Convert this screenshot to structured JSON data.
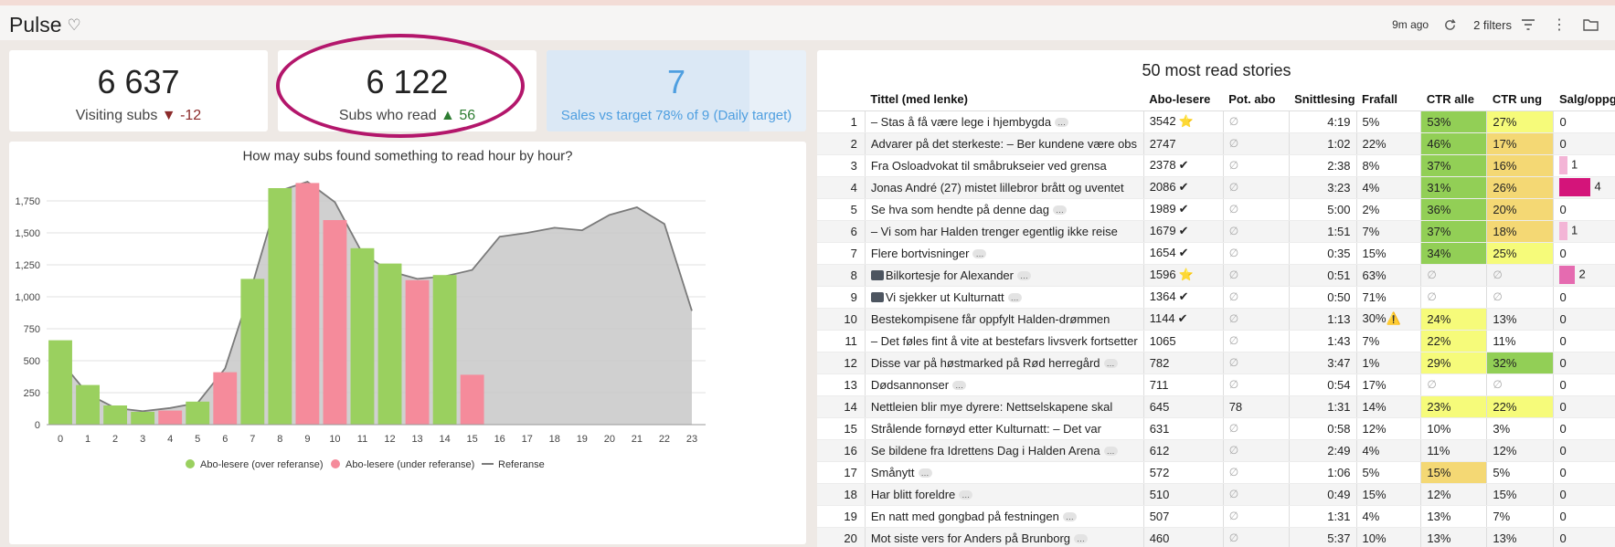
{
  "header": {
    "title": "Pulse",
    "updated": "9m ago",
    "filters": "2 filters"
  },
  "kpis": [
    {
      "value": "6 637",
      "label": "Visiting subs",
      "delta": "▼ -12",
      "delta_dir": "down"
    },
    {
      "value": "6 122",
      "label": "Subs who read",
      "delta": "▲ 56",
      "delta_dir": "up"
    },
    {
      "value": "7",
      "label": "Sales vs target 78% of 9 (Daily target)",
      "progress": 0.78
    }
  ],
  "colors": {
    "over": "#9ad05f",
    "under": "#f58b9b",
    "reference_area": "#c8c8c8",
    "reference_line": "#7a7a7a",
    "ctr_green": "#92cf56",
    "ctr_yellow": "#f6fb7a",
    "ctr_orange": "#f4d874",
    "sales_bar": "#d4147a"
  },
  "chart_data": {
    "type": "bar",
    "title": "How may subs found something to read hour by hour?",
    "categories": [
      "0",
      "1",
      "2",
      "3",
      "4",
      "5",
      "6",
      "7",
      "8",
      "9",
      "10",
      "11",
      "12",
      "13",
      "14",
      "15",
      "16",
      "17",
      "18",
      "19",
      "20",
      "21",
      "22",
      "23"
    ],
    "ylim": [
      0,
      2000
    ],
    "yticks": [
      "0",
      "250",
      "500",
      "750",
      "1,000",
      "1,250",
      "1,500",
      "1,750"
    ],
    "series": [
      {
        "name": "Abo-lesere (over referanse)",
        "values": [
          660,
          310,
          150,
          100,
          null,
          180,
          null,
          1140,
          1850,
          null,
          null,
          1380,
          1260,
          null,
          1170,
          null,
          null,
          null,
          null,
          null,
          null,
          null,
          null,
          null
        ]
      },
      {
        "name": "Abo-lesere (under referanse)",
        "values": [
          null,
          null,
          null,
          null,
          110,
          null,
          410,
          null,
          null,
          1890,
          1600,
          null,
          null,
          1130,
          null,
          390,
          null,
          null,
          null,
          null,
          null,
          null,
          null,
          null
        ]
      },
      {
        "name": "Referanse",
        "type": "area",
        "values": [
          500,
          240,
          130,
          105,
          130,
          170,
          440,
          1100,
          1830,
          1900,
          1740,
          1340,
          1200,
          1140,
          1160,
          1210,
          1470,
          1500,
          1540,
          1520,
          1640,
          1700,
          1570,
          890
        ]
      }
    ]
  },
  "table": {
    "title": "50 most read stories",
    "columns": [
      "",
      "Tittel (med lenke)",
      "Abo-lesere",
      "Pot. abo",
      "Snittlesing",
      "Frafall",
      "CTR alle",
      "CTR ung",
      "Salg/oppgr"
    ],
    "rows": [
      {
        "idx": "1",
        "title": "– Stas å få være lege i hjembygda",
        "dots": "…",
        "abo": "3542",
        "badge": "⭐",
        "pot": "∅",
        "snitt": "4:19",
        "frafall": "5%",
        "ctr_alle": "53%",
        "ctr_alle_c": "green",
        "ctr_ung": "27%",
        "ctr_ung_c": "yellow",
        "salg": "0",
        "salg_val": 0
      },
      {
        "idx": "2",
        "title": "Advarer på det sterkeste: – Ber kundene være obs",
        "dots": "",
        "abo": "2747",
        "badge": "",
        "pot": "∅",
        "snitt": "1:02",
        "frafall": "22%",
        "ctr_alle": "46%",
        "ctr_alle_c": "green",
        "ctr_ung": "17%",
        "ctr_ung_c": "orange",
        "salg": "0",
        "salg_val": 0
      },
      {
        "idx": "3",
        "title": "Fra Osloadvokat til småbrukseier ved grensa",
        "dots": "",
        "abo": "2378",
        "badge": "✔",
        "pot": "∅",
        "snitt": "2:38",
        "frafall": "8%",
        "ctr_alle": "37%",
        "ctr_alle_c": "green",
        "ctr_ung": "16%",
        "ctr_ung_c": "orange",
        "salg": "1",
        "salg_val": 1
      },
      {
        "idx": "4",
        "title": "Jonas André (27) mistet lillebror brått og uventet",
        "dots": "",
        "abo": "2086",
        "badge": "✔",
        "pot": "∅",
        "snitt": "3:23",
        "frafall": "4%",
        "ctr_alle": "31%",
        "ctr_alle_c": "green",
        "ctr_ung": "26%",
        "ctr_ung_c": "orange",
        "salg": "4",
        "salg_val": 4
      },
      {
        "idx": "5",
        "title": "Se hva som hendte på denne dag",
        "dots": "…",
        "abo": "1989",
        "badge": "✔",
        "pot": "∅",
        "snitt": "5:00",
        "frafall": "2%",
        "ctr_alle": "36%",
        "ctr_alle_c": "green",
        "ctr_ung": "20%",
        "ctr_ung_c": "orange",
        "salg": "0",
        "salg_val": 0
      },
      {
        "idx": "6",
        "title": "– Vi som har Halden trenger egentlig ikke reise",
        "dots": "",
        "abo": "1679",
        "badge": "✔",
        "pot": "∅",
        "snitt": "1:51",
        "frafall": "7%",
        "ctr_alle": "37%",
        "ctr_alle_c": "green",
        "ctr_ung": "18%",
        "ctr_ung_c": "orange",
        "salg": "1",
        "salg_val": 1
      },
      {
        "idx": "7",
        "title": "Flere bortvisninger",
        "dots": "…",
        "abo": "1654",
        "badge": "✔",
        "pot": "∅",
        "snitt": "0:35",
        "frafall": "15%",
        "ctr_alle": "34%",
        "ctr_alle_c": "green",
        "ctr_ung": "25%",
        "ctr_ung_c": "yellow",
        "salg": "0",
        "salg_val": 0
      },
      {
        "idx": "8",
        "title": "Bilkortesje for Alexander",
        "tv": true,
        "dots": "…",
        "abo": "1596",
        "badge": "⭐",
        "pot": "∅",
        "snitt": "0:51",
        "frafall": "63%",
        "ctr_alle": "∅",
        "ctr_alle_c": "",
        "ctr_ung": "∅",
        "ctr_ung_c": "",
        "salg": "2",
        "salg_val": 2
      },
      {
        "idx": "9",
        "title": "Vi sjekker ut Kulturnatt",
        "tv": true,
        "dots": "…",
        "abo": "1364",
        "badge": "✔",
        "pot": "∅",
        "snitt": "0:50",
        "frafall": "71%",
        "ctr_alle": "∅",
        "ctr_alle_c": "",
        "ctr_ung": "∅",
        "ctr_ung_c": "",
        "salg": "0",
        "salg_val": 0
      },
      {
        "idx": "10",
        "title": "Bestekompisene får oppfylt Halden-drømmen",
        "dots": "",
        "abo": "1144",
        "badge": "✔",
        "pot": "∅",
        "snitt": "1:13",
        "frafall": "30%⚠️",
        "ctr_alle": "24%",
        "ctr_alle_c": "yellow",
        "ctr_ung": "13%",
        "ctr_ung_c": "",
        "salg": "0",
        "salg_val": 0
      },
      {
        "idx": "11",
        "title": "– Det føles fint å vite at bestefars livsverk fortsetter",
        "dots": "",
        "abo": "1065",
        "badge": "",
        "pot": "∅",
        "snitt": "1:43",
        "frafall": "7%",
        "ctr_alle": "22%",
        "ctr_alle_c": "yellow",
        "ctr_ung": "11%",
        "ctr_ung_c": "",
        "salg": "0",
        "salg_val": 0
      },
      {
        "idx": "12",
        "title": "Disse var på høstmarked på Rød herregård",
        "dots": "…",
        "abo": "782",
        "badge": "",
        "pot": "∅",
        "snitt": "3:47",
        "frafall": "1%",
        "ctr_alle": "29%",
        "ctr_alle_c": "yellow",
        "ctr_ung": "32%",
        "ctr_ung_c": "green",
        "salg": "0",
        "salg_val": 0
      },
      {
        "idx": "13",
        "title": "Dødsannonser",
        "dots": "…",
        "abo": "711",
        "badge": "",
        "pot": "∅",
        "snitt": "0:54",
        "frafall": "17%",
        "ctr_alle": "∅",
        "ctr_alle_c": "",
        "ctr_ung": "∅",
        "ctr_ung_c": "",
        "salg": "0",
        "salg_val": 0
      },
      {
        "idx": "14",
        "title": "Nettleien blir mye dyrere: Nettselskapene skal",
        "dots": "",
        "abo": "645",
        "badge": "",
        "pot": "78",
        "snitt": "1:31",
        "frafall": "14%",
        "ctr_alle": "23%",
        "ctr_alle_c": "yellow",
        "ctr_ung": "22%",
        "ctr_ung_c": "yellow",
        "salg": "0",
        "salg_val": 0
      },
      {
        "idx": "15",
        "title": "Strålende fornøyd etter Kulturnatt: – Det var",
        "dots": "",
        "abo": "631",
        "badge": "",
        "pot": "∅",
        "snitt": "0:58",
        "frafall": "12%",
        "ctr_alle": "10%",
        "ctr_alle_c": "",
        "ctr_ung": "3%",
        "ctr_ung_c": "",
        "salg": "0",
        "salg_val": 0
      },
      {
        "idx": "16",
        "title": "Se bildene fra Idrettens Dag i Halden Arena",
        "dots": "…",
        "abo": "612",
        "badge": "",
        "pot": "∅",
        "snitt": "2:49",
        "frafall": "4%",
        "ctr_alle": "11%",
        "ctr_alle_c": "",
        "ctr_ung": "12%",
        "ctr_ung_c": "",
        "salg": "0",
        "salg_val": 0
      },
      {
        "idx": "17",
        "title": "Smånytt",
        "dots": "…",
        "abo": "572",
        "badge": "",
        "pot": "∅",
        "snitt": "1:06",
        "frafall": "5%",
        "ctr_alle": "15%",
        "ctr_alle_c": "orange",
        "ctr_ung": "5%",
        "ctr_ung_c": "",
        "salg": "0",
        "salg_val": 0
      },
      {
        "idx": "18",
        "title": "Har blitt foreldre",
        "dots": "…",
        "abo": "510",
        "badge": "",
        "pot": "∅",
        "snitt": "0:49",
        "frafall": "15%",
        "ctr_alle": "12%",
        "ctr_alle_c": "",
        "ctr_ung": "15%",
        "ctr_ung_c": "",
        "salg": "0",
        "salg_val": 0
      },
      {
        "idx": "19",
        "title": "En natt med gongbad på festningen",
        "dots": "…",
        "abo": "507",
        "badge": "",
        "pot": "∅",
        "snitt": "1:31",
        "frafall": "4%",
        "ctr_alle": "13%",
        "ctr_alle_c": "",
        "ctr_ung": "7%",
        "ctr_ung_c": "",
        "salg": "0",
        "salg_val": 0
      },
      {
        "idx": "20",
        "title": "Mot siste vers for Anders på Brunborg",
        "dots": "…",
        "abo": "460",
        "badge": "",
        "pot": "∅",
        "snitt": "5:37",
        "frafall": "10%",
        "ctr_alle": "13%",
        "ctr_alle_c": "",
        "ctr_ung": "13%",
        "ctr_ung_c": "",
        "salg": "0",
        "salg_val": 0
      }
    ]
  }
}
